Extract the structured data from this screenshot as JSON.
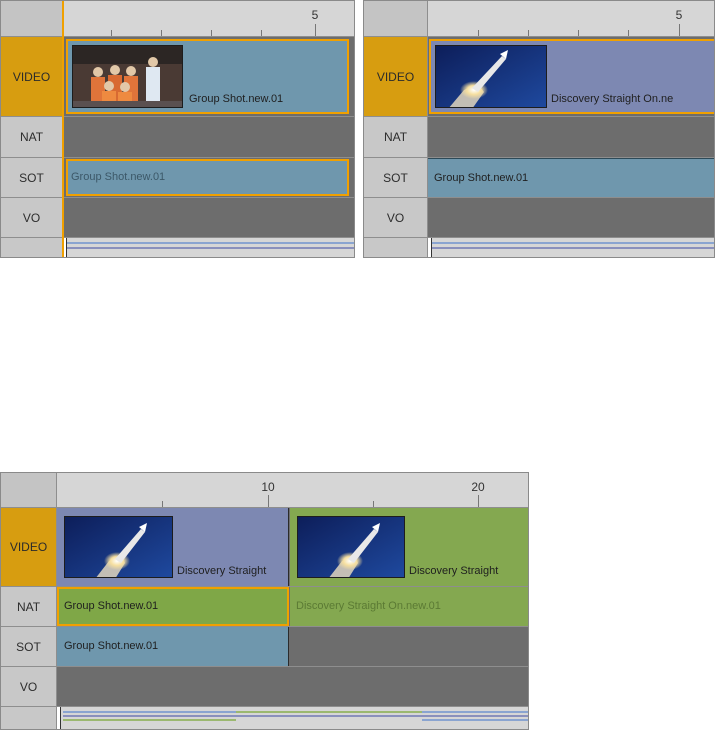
{
  "panels": [
    {
      "ruler": {
        "numbers": [
          "5"
        ]
      },
      "tracks": {
        "video": "VIDEO",
        "nat": "NAT",
        "sot": "SOT",
        "vo": "VO"
      },
      "clips": {
        "video": "Group Shot.new.01",
        "sot": "Group Shot.new.01"
      }
    },
    {
      "ruler": {
        "numbers": [
          "5"
        ]
      },
      "tracks": {
        "video": "VIDEO",
        "nat": "NAT",
        "sot": "SOT",
        "vo": "VO"
      },
      "clips": {
        "video": "Discovery Straight On.ne",
        "sot": "Group Shot.new.01"
      }
    },
    {
      "ruler": {
        "numbers": [
          "10",
          "20"
        ]
      },
      "tracks": {
        "video": "VIDEO",
        "nat": "NAT",
        "sot": "SOT",
        "vo": "VO"
      },
      "clips": {
        "video_a": "Discovery Straight",
        "video_b": "Discovery Straight",
        "nat_a": "Group Shot.new.01",
        "nat_b": "Discovery Straight On.new.01",
        "sot": "Group Shot.new.01"
      }
    }
  ],
  "colors": {
    "video_blue": "#7d88b2",
    "video_green": "#84a850",
    "sot_blue": "#6f97ad",
    "nat_green": "#7fa747",
    "selection": "#f0a000",
    "label_video": "#d79d10",
    "empty_track": "#6d6d6d"
  }
}
